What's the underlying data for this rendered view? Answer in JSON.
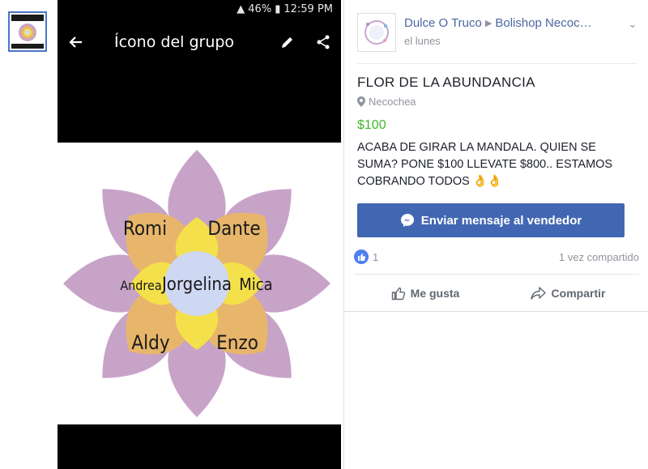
{
  "phone": {
    "status": {
      "battery": "46%",
      "time": "12:59 PM"
    },
    "appbar": {
      "title": "Ícono del grupo"
    },
    "mandala": {
      "center_name": "Jorgelina",
      "names": [
        "Romi",
        "Dante",
        "Andrea",
        "Mica",
        "Aldy",
        "Enzo"
      ]
    }
  },
  "store": {
    "seller": "Dulce O Truco",
    "group": "Bolishop Necoc…",
    "time": "el lunes"
  },
  "listing": {
    "title": "FLOR DE LA ABUNDANCIA",
    "location": "Necochea",
    "price": "$100",
    "description": "ACABA DE GIRAR LA MANDALA. QUIEN SE SUMA? PONE $100 LLEVATE $800.. ESTAMOS COBRANDO TODOS 👌👌"
  },
  "actions": {
    "message_button": "Enviar mensaje al vendedor",
    "like_count": "1",
    "shares": "1 vez compartido",
    "like": "Me gusta",
    "share": "Compartir"
  },
  "colors": {
    "accent": "#4267b2",
    "price": "#42b72a",
    "petal_outer": "#c8a3c8",
    "petal_middle": "#e7b66b",
    "petal_inner": "#f4e04a",
    "center": "#cfd8f3"
  }
}
